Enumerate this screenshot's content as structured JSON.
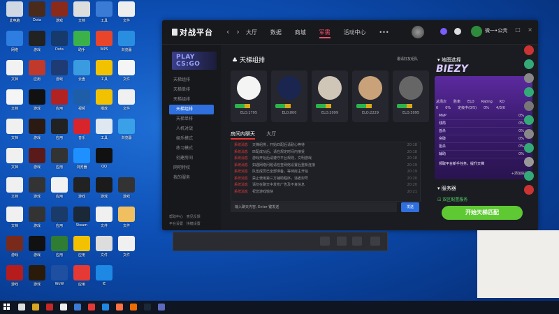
{
  "app": {
    "logo": "对战平台",
    "nav": [
      "大厅",
      "数据",
      "商城",
      "军需",
      "活动中心",
      "•••"
    ],
    "nav_active": "军需",
    "user_name": "微一•公共",
    "win_buttons": [
      "—",
      "□",
      "×"
    ]
  },
  "sidebar": {
    "title": "PLAY CS:GO",
    "items": [
      "天梯组排",
      "天梯单排",
      "天梯组排"
    ],
    "sub_items": [
      "天梯组排",
      "天梯单排",
      "人机对战",
      "娱乐模式",
      "练习模式",
      "创建房间"
    ],
    "bottom_items": [
      "网吧特权",
      "我的服务"
    ],
    "footer": [
      "帮助中心",
      "意见反馈",
      "平台设置",
      "快捷设置"
    ]
  },
  "main": {
    "section_title": "天梯组排",
    "section_link": "邀请好友组队",
    "players": [
      {
        "elo": "ELO:1795"
      },
      {
        "elo": "ELO:800"
      },
      {
        "elo": "ELO:2099"
      },
      {
        "elo": "ELO:2229"
      },
      {
        "elo": "ELO:3095"
      }
    ],
    "tabs": [
      "房间内聊天",
      "大厅"
    ],
    "chat_tag": "系统消息",
    "chat_lines": [
      "天梯组排，开始匹配后请耐心等待",
      "匹配成功后，请在规定时间内接受",
      "游戏开始后请遵守平台规则，文明游戏",
      "如遇网络问题请检查网络设置后重新连接",
      "队伍成员已全部准备，等待房主开始",
      "禁止使用第三方辅助程序，违者封号",
      "请勿在聊天中发布广告及不良信息",
      "祝您游戏愉快"
    ],
    "chat_times": [
      "20:18",
      "20:18",
      "20:18",
      "20:19",
      "20:19",
      "20:20",
      "20:20",
      "20:21"
    ],
    "chat_placeholder": "输入聊天内容, Enter 键发送",
    "send_label": "发送"
  },
  "right": {
    "map_title": "地图选择",
    "panel_brand": "BIEZY",
    "stat_headers": [
      "总场次",
      "胜率",
      "ELO",
      "Rating",
      "KD"
    ],
    "stat_values": [
      "0",
      "0%",
      "定级中(0/5)",
      "0%",
      "4/3/0"
    ],
    "ranks": [
      {
        "label": "MVP",
        "value": "0%"
      },
      {
        "label": "残局",
        "value": "0%"
      },
      {
        "label": "首杀",
        "value": "0%"
      },
      {
        "label": "突破",
        "value": "0%"
      },
      {
        "label": "狙杀",
        "value": "0%"
      },
      {
        "label": "辅助",
        "value": "0%"
      }
    ],
    "panel_note": "领取平台新手任务，提升天梯",
    "panel_link": "+添加好友",
    "server_title": "服务器",
    "server_item": "双区配置服务",
    "start_button": "开始天梯匹配"
  },
  "colors": {
    "accent": "#ff4f6b",
    "primary_blue": "#2f6fde",
    "start_green": "#5ec933",
    "panel_purple": "#5c2a9f"
  }
}
